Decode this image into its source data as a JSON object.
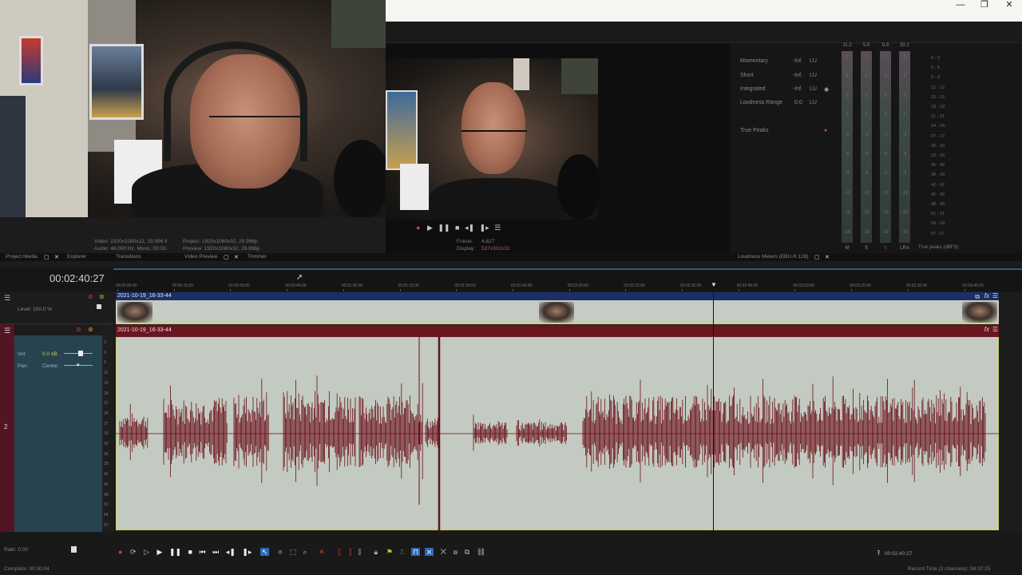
{
  "window": {
    "minimize": "—",
    "restore": "❐",
    "close": "✕"
  },
  "preview": {
    "video_info": "Video: 1920x1080x12, 29.996 fr",
    "audio_info": "Audio: 48,000 Hz, Mono, 00:03:",
    "project_info": "Project:  1920x1080x32, 29.996p",
    "preview_info": "Preview:  1920x1080x32, 29.996p",
    "frame_label": "Frame:",
    "frame_value": "4,827",
    "display_label": "Display:",
    "display_value": "537x302x32"
  },
  "loudness": {
    "rows": [
      {
        "label": "Momentary",
        "value": "-Inf.",
        "unit": "LU"
      },
      {
        "label": "Short",
        "value": "-Inf.",
        "unit": "LU"
      },
      {
        "label": "Integrated",
        "value": "-Inf.",
        "unit": "LU"
      },
      {
        "label": "Loudness Range",
        "value": "0.0",
        "unit": "LU"
      }
    ],
    "true_peaks": "True Peaks",
    "meter_tops": [
      "11.2",
      "5.9",
      "8.8",
      "30.1"
    ],
    "meter_labels": [
      "M",
      "S",
      "I",
      "LRA"
    ],
    "peaks_caption": "True peaks (dBFS)",
    "peak_scale": [
      "3",
      "6",
      "9",
      "12",
      "15",
      "18",
      "21",
      "24",
      "27",
      "30",
      "33",
      "36",
      "39",
      "42",
      "45",
      "48",
      "51",
      "54",
      "57"
    ]
  },
  "tabs": {
    "project_media": "Project Media",
    "explorer": "Explorer",
    "transitions": "Transitions",
    "video_preview": "Video Preview",
    "trimmer": "Trimmer",
    "loudness_meters": "Loudness Meters (EBU R 128)"
  },
  "timeline": {
    "timecode": "00:02:40:27",
    "ruler": [
      "00:00:00:00",
      "00:00:15:00",
      "00:00:30:00",
      "00:00:45:00",
      "00:01:00:00",
      "00:01:15:00",
      "00:01:30:00",
      "00:01:45:00",
      "00:02:00:00",
      "00:02:15:00",
      "00:02:30:00",
      "00:02:45:00",
      "00:03:00:00",
      "00:03:15:00",
      "00:03:30:00",
      "00:03:45:00"
    ],
    "video_track": {
      "level": "Level: 100.0 %",
      "clip": "2021-10-19_16-33-44"
    },
    "audio_track": {
      "vol_label": "Vol:",
      "vol_value": "0.0 dB",
      "pan_label": "Pan:",
      "pan_value": "Center",
      "clip": "2021-10-19_16-33-44",
      "number": "2"
    },
    "db_scale": [
      "3",
      "6",
      "9",
      "12",
      "15",
      "18",
      "21",
      "24",
      "27",
      "30",
      "33",
      "36",
      "39",
      "42",
      "45",
      "48",
      "51",
      "54",
      "57"
    ]
  },
  "transport": {
    "rate": "Rate: 0.00",
    "status": "Complete: 00:00:04",
    "record_time": "Record Time (2 channels): 34:37:15",
    "cursor_time": "00:02:40:27"
  }
}
